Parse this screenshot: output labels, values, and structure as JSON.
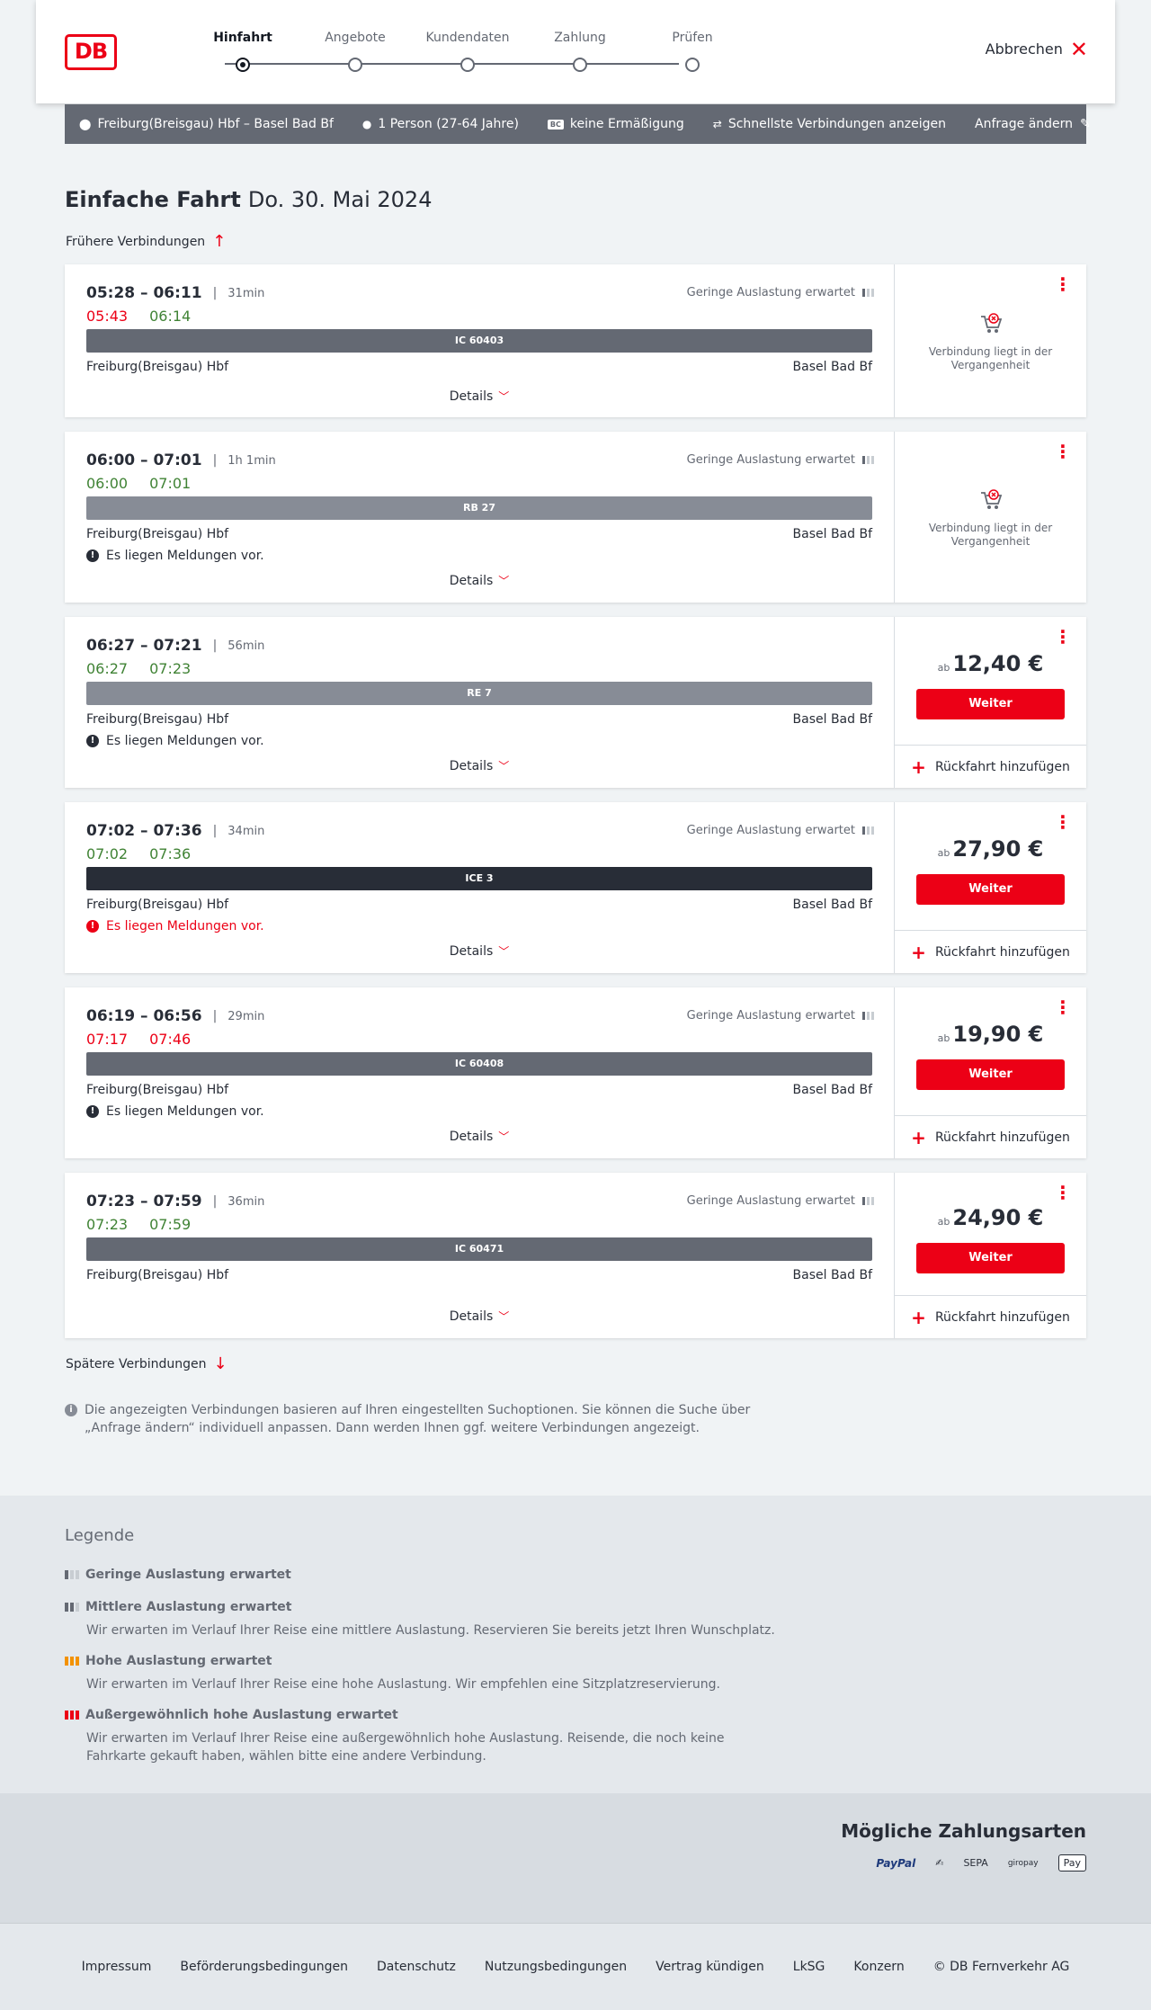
{
  "header": {
    "logo": "DB",
    "steps": [
      "Hinfahrt",
      "Angebote",
      "Kundendaten",
      "Zahlung",
      "Prüfen"
    ],
    "cancel": "Abbrechen"
  },
  "query": {
    "route": "Freiburg(Breisgau) Hbf – Basel Bad Bf",
    "persons": "1 Person (27-64 Jahre)",
    "bc_badge": "BC",
    "discount": "keine Ermäßigung",
    "fastest": "Schnellste Verbindungen anzeigen",
    "change": "Anfrage ändern"
  },
  "title": {
    "type": "Einfache Fahrt",
    "date": "Do. 30. Mai 2024"
  },
  "earlier": "Frühere Verbindungen",
  "later": "Spätere Verbindungen",
  "labels": {
    "occupancy": "Geringe Auslastung erwartet",
    "details": "Details",
    "past": "Verbindung liegt in der Vergangenheit",
    "ab": "ab",
    "weiter": "Weiter",
    "return": "Rückfahrt hinzufügen",
    "messages": "Es liegen Meldungen vor."
  },
  "connections": [
    {
      "times": "05:28 – 06:11",
      "duration": "31min",
      "rt_dep": "05:43",
      "rt_arr": "06:14",
      "train": "IC 60403",
      "from": "Freiburg(Breisgau) Hbf",
      "to": "Basel Bad Bf"
    },
    {
      "times": "06:00 – 07:01",
      "duration": "1h 1min",
      "rt_dep": "06:00",
      "rt_arr": "07:01",
      "train": "RB 27",
      "from": "Freiburg(Breisgau) Hbf",
      "to": "Basel Bad Bf"
    },
    {
      "times": "06:27 – 07:21",
      "duration": "56min",
      "rt_dep": "06:27",
      "rt_arr": "07:23",
      "train": "RE 7",
      "from": "Freiburg(Breisgau) Hbf",
      "to": "Basel Bad Bf",
      "price": "12,40 €"
    },
    {
      "times": "07:02 – 07:36",
      "duration": "34min",
      "rt_dep": "07:02",
      "rt_arr": "07:36",
      "train": "ICE 3",
      "from": "Freiburg(Breisgau) Hbf",
      "to": "Basel Bad Bf",
      "price": "27,90 €"
    },
    {
      "times": "06:19 – 06:56",
      "duration": "29min",
      "rt_dep": "07:17",
      "rt_arr": "07:46",
      "train": "IC 60408",
      "from": "Freiburg(Breisgau) Hbf",
      "to": "Basel Bad Bf",
      "price": "19,90 €"
    },
    {
      "times": "07:23 – 07:59",
      "duration": "36min",
      "rt_dep": "07:23",
      "rt_arr": "07:59",
      "train": "IC 60471",
      "from": "Freiburg(Breisgau) Hbf",
      "to": "Basel Bad Bf",
      "price": "24,90 €"
    }
  ],
  "info": "Die angezeigten Verbindungen basieren auf Ihren eingestellten Suchoptionen. Sie können die Suche über „Anfrage ändern“ individuell anpassen. Dann werden Ihnen ggf. weitere Verbindungen angezeigt.",
  "legend": {
    "title": "Legende",
    "items": [
      {
        "title": "Geringe Auslastung erwartet",
        "desc": ""
      },
      {
        "title": "Mittlere Auslastung erwartet",
        "desc": "Wir erwarten im Verlauf Ihrer Reise eine mittlere Auslastung. Reservieren Sie bereits jetzt Ihren Wunschplatz."
      },
      {
        "title": "Hohe Auslastung erwartet",
        "desc": "Wir erwarten im Verlauf Ihrer Reise eine hohe Auslastung. Wir empfehlen eine Sitzplatzreservierung."
      },
      {
        "title": "Außergewöhnlich hohe Auslastung erwartet",
        "desc": "Wir erwarten im Verlauf Ihrer Reise eine außergewöhnlich hohe Auslastung. Reisende, die noch keine Fahrkarte gekauft haben, wählen bitte eine andere Verbindung."
      }
    ]
  },
  "payments": {
    "title": "Mögliche Zahlungsarten",
    "paypal": "PayPal",
    "sepa": "SEPA",
    "giropay": "giropay",
    "applepay": "Pay"
  },
  "footer": {
    "links": [
      "Impressum",
      "Beförderungsbedingungen",
      "Datenschutz",
      "Nutzungsbedingungen",
      "Vertrag kündigen",
      "LkSG",
      "Konzern",
      "© DB Fernverkehr AG"
    ]
  },
  "colors": {
    "accent": "#ec0016",
    "ontime": "#408335",
    "ic_bar": "#646973",
    "regional_bar": "#878c96",
    "ice_bar": "#282d37"
  }
}
